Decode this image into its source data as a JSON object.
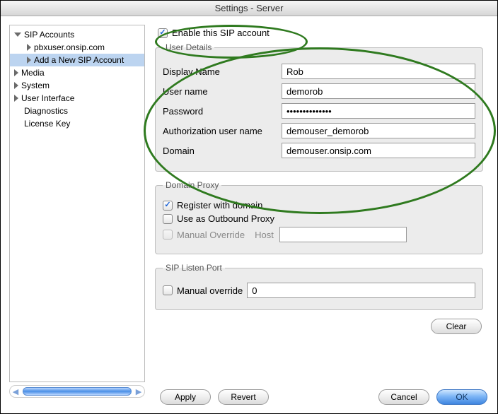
{
  "window": {
    "title": "Settings - Server"
  },
  "sidebar": {
    "items": [
      {
        "label": "SIP Accounts",
        "disclosure": "down"
      },
      {
        "label": "pbxuser.onsip.com",
        "indent": 1,
        "disclosure": "right"
      },
      {
        "label": "Add a New SIP Account",
        "indent": 1,
        "disclosure": "right",
        "selected": true
      },
      {
        "label": "Media",
        "disclosure": "right"
      },
      {
        "label": "System",
        "disclosure": "right"
      },
      {
        "label": "User Interface",
        "disclosure": "right"
      },
      {
        "label": "Diagnostics"
      },
      {
        "label": "License Key"
      }
    ]
  },
  "enable": {
    "label": "Enable this SIP account",
    "checked": true
  },
  "userDetails": {
    "legend": "User Details",
    "displayName": {
      "label": "Display Name",
      "value": "Rob"
    },
    "userName": {
      "label": "User name",
      "value": "demorob"
    },
    "password": {
      "label": "Password",
      "value": "••••••••••••••"
    },
    "authUser": {
      "label": "Authorization user name",
      "value": "demouser_demorob"
    },
    "domain": {
      "label": "Domain",
      "value": "demouser.onsip.com"
    }
  },
  "domainProxy": {
    "legend": "Domain Proxy",
    "register": {
      "label": "Register with domain",
      "checked": true
    },
    "outbound": {
      "label": "Use as Outbound Proxy",
      "checked": false
    },
    "manual": {
      "label": "Manual Override",
      "checked": false,
      "disabled": true
    },
    "hostLabel": "Host",
    "hostValue": ""
  },
  "listenPort": {
    "legend": "SIP Listen Port",
    "manual": {
      "label": "Manual override",
      "checked": false
    },
    "value": "0"
  },
  "buttons": {
    "clear": "Clear",
    "apply": "Apply",
    "revert": "Revert",
    "cancel": "Cancel",
    "ok": "OK"
  }
}
